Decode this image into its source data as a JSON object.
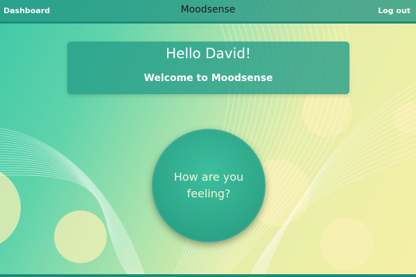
{
  "header": {
    "dashboard_label": "Dashboard",
    "app_title": "Moodsense",
    "logout_label": "Log out"
  },
  "welcome": {
    "greeting": "Hello David!",
    "subtitle": "Welcome to Moodsense"
  },
  "main": {
    "feeling_prompt": "How are you feeling?"
  },
  "colors": {
    "primary_teal": "#2ea88a",
    "header_teal": "#249684",
    "light_yellow": "#f5f0a6",
    "text_light": "#f7f4d4"
  }
}
